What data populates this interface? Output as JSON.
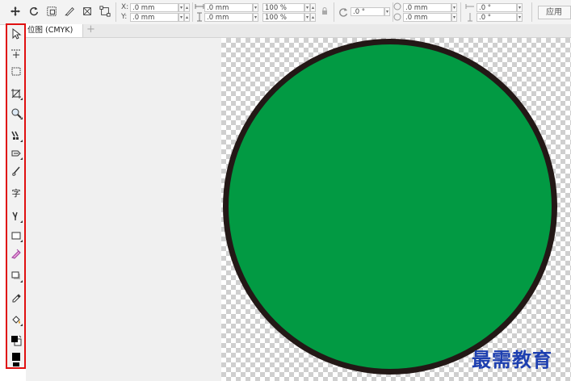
{
  "property_bar": {
    "x_label": "X:",
    "y_label": "Y:",
    "x_value": ".0 mm",
    "y_value": ".0 mm",
    "width_value": ".0 mm",
    "height_value": ".0 mm",
    "scale_x": "100 %",
    "scale_y": "100 %",
    "rotation": ".0 °",
    "x2_value": ".0 mm",
    "y2_value": ".0 mm",
    "skew_h": ".0 °",
    "skew_v": ".0 °",
    "apply_label": "应用"
  },
  "tabs": [
    {
      "label": "位图 (CMYK)",
      "active": true
    }
  ],
  "toolbox": {
    "text_tool_char": "字"
  },
  "document": {
    "shape": "circle",
    "fill_color": "#029a43",
    "outline_color": "#231816"
  },
  "watermark": "最需教育"
}
